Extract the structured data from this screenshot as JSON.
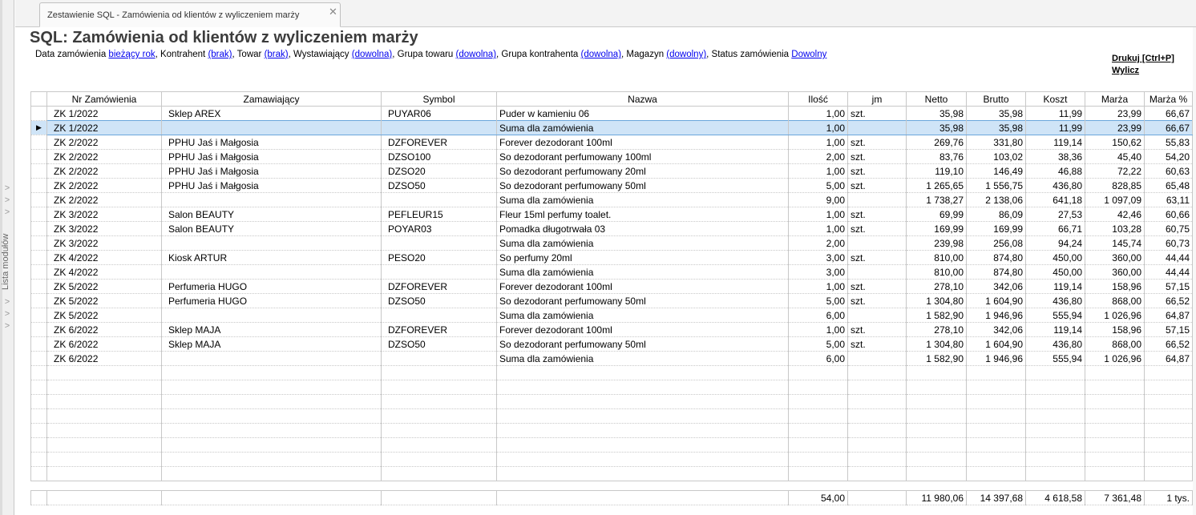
{
  "sidebar": {
    "label": "Lista modułów",
    "chevrons_top": [
      ">",
      ">",
      ">"
    ],
    "chevrons_bottom": [
      ">",
      ">",
      ">"
    ]
  },
  "tab": {
    "label": "Zestawienie SQL - Zamówienia od klientów z wyliczeniem marży",
    "close": "✕"
  },
  "page": {
    "title": "SQL: Zamówienia od klientów z wyliczeniem marży"
  },
  "filters": [
    {
      "label": "Data zamówienia",
      "value": "bieżący rok"
    },
    {
      "label": "Kontrahent",
      "value": "(brak)"
    },
    {
      "label": "Towar",
      "value": "(brak)"
    },
    {
      "label": "Wystawiający",
      "value": "(dowolna)"
    },
    {
      "label": "Grupa towaru",
      "value": "(dowolna)"
    },
    {
      "label": "Grupa kontrahenta",
      "value": "(dowolna)"
    },
    {
      "label": "Magazyn",
      "value": "(dowolny)"
    },
    {
      "label": "Status zamówienia",
      "value": "Dowolny"
    }
  ],
  "actions": {
    "print": "Drukuj [Ctrl+P]",
    "calculate": "Wylicz"
  },
  "table": {
    "columns": [
      "Nr Zamówienia",
      "Zamawiający",
      "Symbol",
      "Nazwa",
      "Ilość",
      "jm",
      "Netto",
      "Brutto",
      "Koszt",
      "Marża",
      "Marża %"
    ],
    "selected_row": 1,
    "rows": [
      [
        "ZK 1/2022",
        "Sklep AREX",
        "PUYAR06",
        "Puder w kamieniu 06",
        "1,00",
        "szt.",
        "35,98",
        "35,98",
        "11,99",
        "23,99",
        "66,67"
      ],
      [
        "ZK 1/2022",
        "",
        "",
        "Suma dla zamówienia",
        "1,00",
        "",
        "35,98",
        "35,98",
        "11,99",
        "23,99",
        "66,67"
      ],
      [
        "ZK 2/2022",
        "PPHU Jaś i Małgosia",
        "DZFOREVER",
        "Forever dezodorant 100ml",
        "1,00",
        "szt.",
        "269,76",
        "331,80",
        "119,14",
        "150,62",
        "55,83"
      ],
      [
        "ZK 2/2022",
        "PPHU Jaś i Małgosia",
        "DZSO100",
        "So dezodorant perfumowany 100ml",
        "2,00",
        "szt.",
        "83,76",
        "103,02",
        "38,36",
        "45,40",
        "54,20"
      ],
      [
        "ZK 2/2022",
        "PPHU Jaś i Małgosia",
        "DZSO20",
        "So dezodorant perfumowany 20ml",
        "1,00",
        "szt.",
        "119,10",
        "146,49",
        "46,88",
        "72,22",
        "60,63"
      ],
      [
        "ZK 2/2022",
        "PPHU Jaś i Małgosia",
        "DZSO50",
        "So dezodorant perfumowany 50ml",
        "5,00",
        "szt.",
        "1 265,65",
        "1 556,75",
        "436,80",
        "828,85",
        "65,48"
      ],
      [
        "ZK 2/2022",
        "",
        "",
        "Suma dla zamówienia",
        "9,00",
        "",
        "1 738,27",
        "2 138,06",
        "641,18",
        "1 097,09",
        "63,11"
      ],
      [
        "ZK 3/2022",
        "Salon BEAUTY",
        "PEFLEUR15",
        "Fleur 15ml perfumy toalet.",
        "1,00",
        "szt.",
        "69,99",
        "86,09",
        "27,53",
        "42,46",
        "60,66"
      ],
      [
        "ZK 3/2022",
        "Salon BEAUTY",
        "POYAR03",
        "Pomadka długotrwała 03",
        "1,00",
        "szt.",
        "169,99",
        "169,99",
        "66,71",
        "103,28",
        "60,75"
      ],
      [
        "ZK 3/2022",
        "",
        "",
        "Suma dla zamówienia",
        "2,00",
        "",
        "239,98",
        "256,08",
        "94,24",
        "145,74",
        "60,73"
      ],
      [
        "ZK 4/2022",
        "Kiosk ARTUR",
        "PESO20",
        "So perfumy 20ml",
        "3,00",
        "szt.",
        "810,00",
        "874,80",
        "450,00",
        "360,00",
        "44,44"
      ],
      [
        "ZK 4/2022",
        "",
        "",
        "Suma dla zamówienia",
        "3,00",
        "",
        "810,00",
        "874,80",
        "450,00",
        "360,00",
        "44,44"
      ],
      [
        "ZK 5/2022",
        "Perfumeria HUGO",
        "DZFOREVER",
        "Forever dezodorant 100ml",
        "1,00",
        "szt.",
        "278,10",
        "342,06",
        "119,14",
        "158,96",
        "57,15"
      ],
      [
        "ZK 5/2022",
        "Perfumeria HUGO",
        "DZSO50",
        "So dezodorant perfumowany 50ml",
        "5,00",
        "szt.",
        "1 304,80",
        "1 604,90",
        "436,80",
        "868,00",
        "66,52"
      ],
      [
        "ZK 5/2022",
        "",
        "",
        "Suma dla zamówienia",
        "6,00",
        "",
        "1 582,90",
        "1 946,96",
        "555,94",
        "1 026,96",
        "64,87"
      ],
      [
        "ZK 6/2022",
        "Sklep MAJA",
        "DZFOREVER",
        "Forever dezodorant 100ml",
        "1,00",
        "szt.",
        "278,10",
        "342,06",
        "119,14",
        "158,96",
        "57,15"
      ],
      [
        "ZK 6/2022",
        "Sklep MAJA",
        "DZSO50",
        "So dezodorant perfumowany 50ml",
        "5,00",
        "szt.",
        "1 304,80",
        "1 604,90",
        "436,80",
        "868,00",
        "66,52"
      ],
      [
        "ZK 6/2022",
        "",
        "",
        "Suma dla zamówienia",
        "6,00",
        "",
        "1 582,90",
        "1 946,96",
        "555,94",
        "1 026,96",
        "64,87"
      ]
    ],
    "footer": [
      "",
      "",
      "",
      "",
      "54,00",
      "",
      "11 980,06",
      "14 397,68",
      "4 618,58",
      "7 361,48",
      "1 tys."
    ]
  },
  "colors": {
    "link": "#0000ee",
    "selected_row": "#cfe4f7",
    "title": "#3c3c3c"
  }
}
